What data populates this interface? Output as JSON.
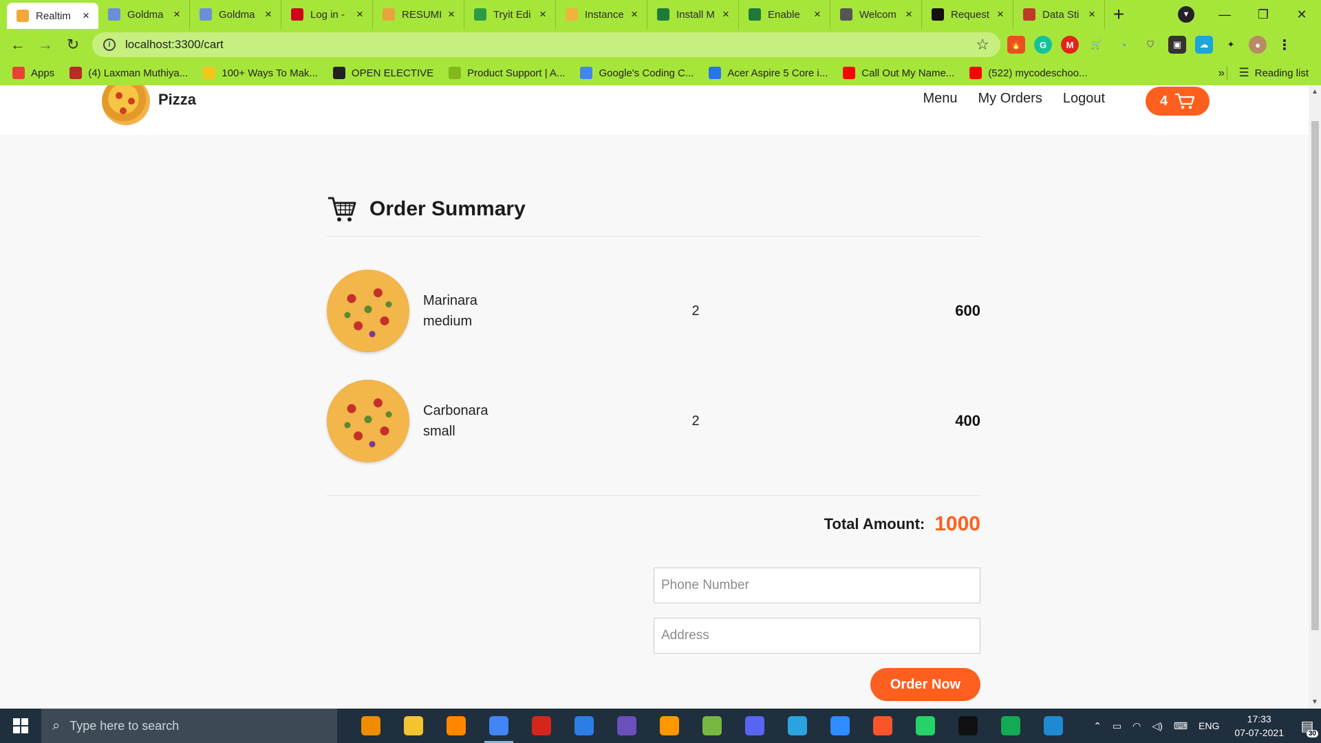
{
  "browser": {
    "tabs": [
      {
        "title": "Realtim",
        "favicon": "pizza-icon",
        "color": "#f3a73b",
        "active": true
      },
      {
        "title": "Goldma",
        "favicon": "doc-icon",
        "color": "#6b8fd6"
      },
      {
        "title": "Goldma",
        "favicon": "doc-icon",
        "color": "#6b8fd6"
      },
      {
        "title": "Log in -",
        "favicon": "opera-icon",
        "color": "#d0021b"
      },
      {
        "title": "RESUMI",
        "favicon": "resume-icon",
        "color": "#e8a33d"
      },
      {
        "title": "Tryit Edi",
        "favicon": "w3-icon",
        "color": "#2c9b44"
      },
      {
        "title": "Instance",
        "favicon": "instance-icon",
        "color": "#f0b43a"
      },
      {
        "title": "Install M",
        "favicon": "mongo-icon",
        "color": "#1e7a3a"
      },
      {
        "title": "Enable",
        "favicon": "mongo-icon",
        "color": "#1e7a3a"
      },
      {
        "title": "Welcom",
        "favicon": "globe-icon",
        "color": "#555555"
      },
      {
        "title": "Request",
        "favicon": "github-icon",
        "color": "#111111"
      },
      {
        "title": "Data Sti",
        "favicon": "udemy-icon",
        "color": "#c0392b"
      }
    ],
    "url": "localhost:3300/cart",
    "bookmarks": [
      {
        "label": "Apps",
        "icon": "apps-grid-icon",
        "color": "#e94235"
      },
      {
        "label": "(4) Laxman Muthiya...",
        "icon": "quora-icon",
        "color": "#b92b27"
      },
      {
        "label": "100+ Ways To Mak...",
        "icon": "bulb-icon",
        "color": "#f5c518"
      },
      {
        "label": "OPEN ELECTIVE",
        "icon": "globe-icon",
        "color": "#222222"
      },
      {
        "label": "Product Support | A...",
        "icon": "acer-icon",
        "color": "#83b81a"
      },
      {
        "label": "Google's Coding C...",
        "icon": "google-icon",
        "color": "#4285f4"
      },
      {
        "label": "Acer Aspire 5 Core i...",
        "icon": "flipkart-icon",
        "color": "#2874f0"
      },
      {
        "label": "Call Out My Name...",
        "icon": "youtube-icon",
        "color": "#ff0000"
      },
      {
        "label": "(522) mycodeschoo...",
        "icon": "youtube-icon",
        "color": "#ff0000"
      }
    ],
    "more_bookmarks": "»",
    "reading_list": "Reading list"
  },
  "site": {
    "brand": "Pizza",
    "nav": [
      "Menu",
      "My Orders",
      "Logout"
    ],
    "cart_count": "4",
    "accent": "#fe5f1e"
  },
  "cart": {
    "title": "Order Summary",
    "items": [
      {
        "name": "Marinara",
        "size": "medium",
        "qty": "2",
        "price": "600"
      },
      {
        "name": "Carbonara",
        "size": "small",
        "qty": "2",
        "price": "400"
      }
    ],
    "total_label": "Total Amount:",
    "total": "1000",
    "phone_placeholder": "Phone Number",
    "address_placeholder": "Address",
    "order_button": "Order Now"
  },
  "taskbar": {
    "search_placeholder": "Type here to search",
    "apps": [
      {
        "icon": "avast-icon",
        "color": "#f08c00"
      },
      {
        "icon": "file-explorer-icon",
        "color": "#f4c430"
      },
      {
        "icon": "vlc-icon",
        "color": "#ff8800"
      },
      {
        "icon": "chrome-icon",
        "color": "#4285f4",
        "open": true
      },
      {
        "icon": "acrobat-icon",
        "color": "#d4261b"
      },
      {
        "icon": "messages-icon",
        "color": "#2b7de9"
      },
      {
        "icon": "snipping-icon",
        "color": "#6b4fbb"
      },
      {
        "icon": "sublime-icon",
        "color": "#ff9800"
      },
      {
        "icon": "utorrent-icon",
        "color": "#76b83f"
      },
      {
        "icon": "discord-icon",
        "color": "#5865f2"
      },
      {
        "icon": "telegram-icon",
        "color": "#2aa3df"
      },
      {
        "icon": "zoom-icon",
        "color": "#2d8cff"
      },
      {
        "icon": "brave-icon",
        "color": "#fb542b"
      },
      {
        "icon": "whatsapp-icon",
        "color": "#25d366"
      },
      {
        "icon": "terminal-icon",
        "color": "#111111"
      },
      {
        "icon": "mongodb-compass-icon",
        "color": "#13aa52"
      },
      {
        "icon": "vscode-icon",
        "color": "#1f8ad2"
      }
    ],
    "language": "ENG",
    "time": "17:33",
    "date": "07-07-2021",
    "notification_count": "30"
  }
}
